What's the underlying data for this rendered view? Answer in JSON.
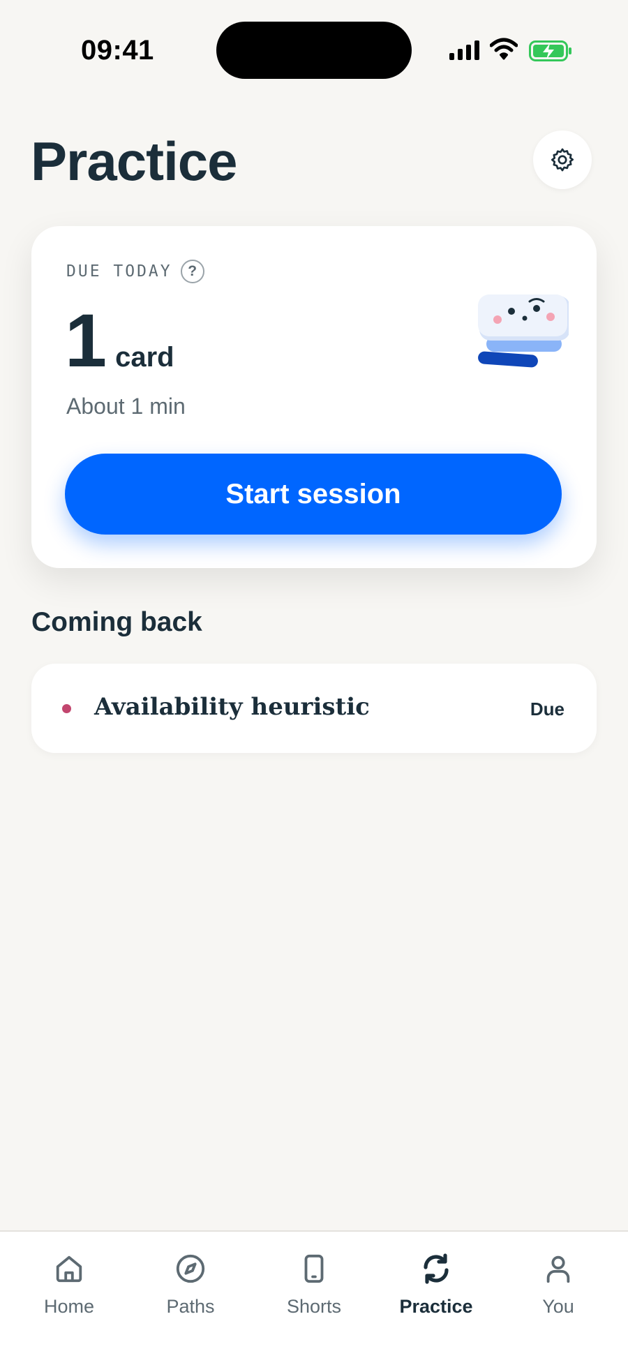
{
  "status_bar": {
    "time": "09:41"
  },
  "header": {
    "title": "Practice",
    "settings_icon": "gear-icon"
  },
  "due_card": {
    "label": "DUE TODAY",
    "help_glyph": "?",
    "count": "1",
    "unit": "card",
    "duration": "About 1 min",
    "button_label": "Start session"
  },
  "coming_back": {
    "heading": "Coming back",
    "items": [
      {
        "title": "Availability heuristic",
        "status": "Due",
        "dot_color": "#c2466e"
      }
    ]
  },
  "tab_bar": {
    "tabs": [
      {
        "label": "Home",
        "icon": "home-icon"
      },
      {
        "label": "Paths",
        "icon": "compass-icon"
      },
      {
        "label": "Shorts",
        "icon": "phone-icon"
      },
      {
        "label": "Practice",
        "icon": "refresh-icon",
        "active": true
      },
      {
        "label": "You",
        "icon": "person-icon"
      }
    ]
  },
  "colors": {
    "background": "#f7f6f3",
    "accent": "#0066ff",
    "text": "#1b2e3a",
    "battery": "#34c759"
  }
}
